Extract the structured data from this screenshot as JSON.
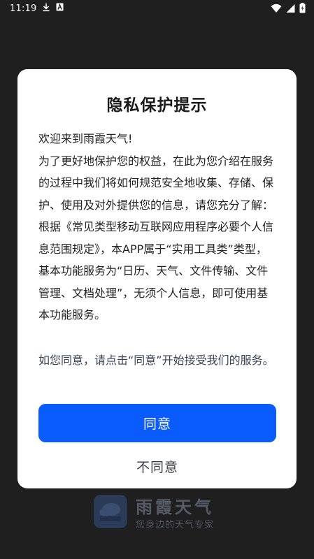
{
  "status_bar": {
    "time": "11:19"
  },
  "background": {
    "app_name": "雨霞天气",
    "tagline": "您身边的天气专家"
  },
  "dialog": {
    "title": "隐私保护提示",
    "body": [
      "欢迎来到雨霞天气!",
      "为了更好地保护您的权益，在此为您介绍在服务的过程中我们将如何规范安全地收集、存储、保护、使用及对外提供您的信息，请您充分了解：",
      "根据《常见类型移动互联网应用程序必要个人信息范围规定》，本APP属于“实用工具类”类型，基本功能服务为“日历、天气、文件传输、文件管理、文档处理”，无须个人信息，即可使用基本功能服务。"
    ],
    "agree_note": "如您同意，请点击“同意”开始接受我们的服务。",
    "agree_label": "同意",
    "disagree_label": "不同意"
  },
  "colors": {
    "primary": "#0b5cff",
    "overlay": "#1f1f1f",
    "dialog_bg": "#ffffff"
  }
}
